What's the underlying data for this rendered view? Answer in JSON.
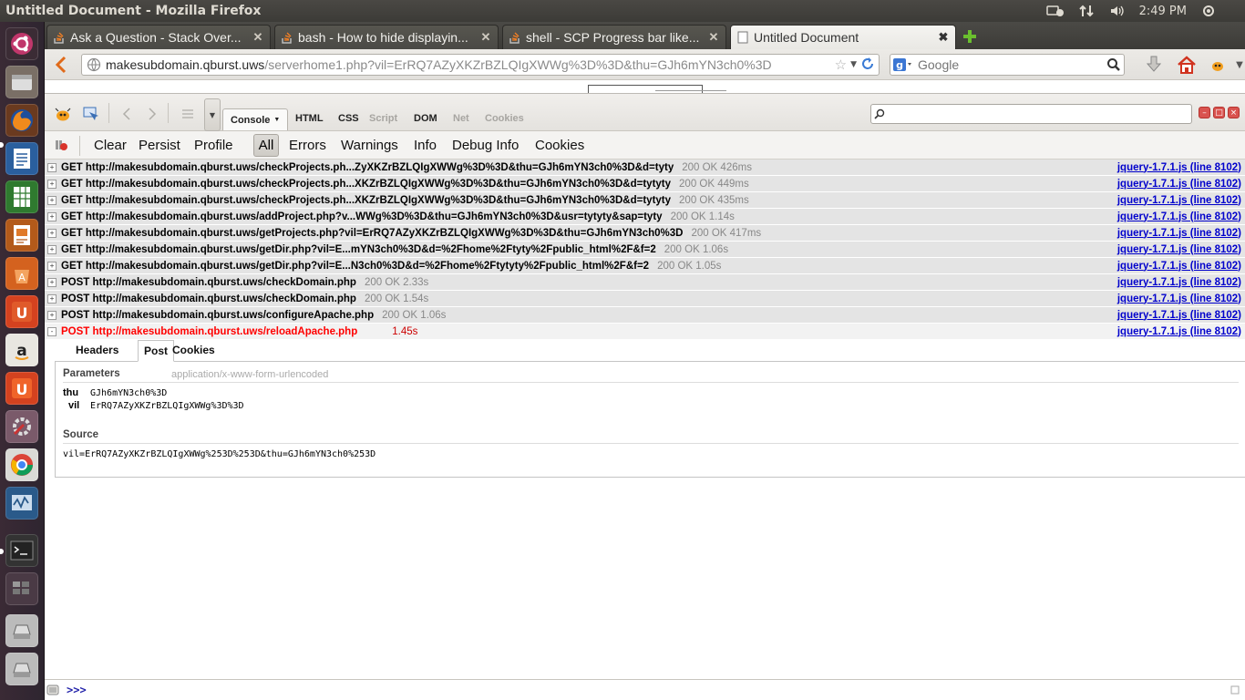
{
  "window": {
    "title": "Untitled Document - Mozilla Firefox",
    "clock": "2:49 PM"
  },
  "tabs": [
    {
      "label": "Ask a Question - Stack Over...",
      "active": false
    },
    {
      "label": "bash - How to hide displayin...",
      "active": false
    },
    {
      "label": "shell - SCP Progress bar like...",
      "active": false
    },
    {
      "label": "Untitled Document",
      "active": true
    }
  ],
  "navbar": {
    "url_domain": "makesubdomain.qburst.uws",
    "url_path": "/serverhome1.php?vil=ErRQ7AZyXKZrBZLQIgXWWg%3D%3D&thu=GJh6mYN3ch0%3D",
    "search_placeholder": "Google"
  },
  "firebug": {
    "console_tab": "Console",
    "panel_tabs": [
      "HTML",
      "CSS",
      "Script",
      "DOM",
      "Net",
      "Cookies"
    ],
    "console_buttons": {
      "clear": "Clear",
      "persist": "Persist",
      "profile": "Profile",
      "all": "All",
      "errors": "Errors",
      "warnings": "Warnings",
      "info": "Info",
      "debug": "Debug Info",
      "cookies": "Cookies"
    },
    "log_rows": [
      {
        "expander": "+",
        "request": "GET http://makesubdomain.qburst.uws/checkProjects.ph...ZyXKZrBZLQIgXWWg%3D%3D&thu=GJh6mYN3ch0%3D&d=tyty",
        "status": "200 OK 426ms",
        "source": "jquery-1.7.1.js (line 8102)"
      },
      {
        "expander": "+",
        "request": "GET http://makesubdomain.qburst.uws/checkProjects.ph...XKZrBZLQIgXWWg%3D%3D&thu=GJh6mYN3ch0%3D&d=tytyty",
        "status": "200 OK 449ms",
        "source": "jquery-1.7.1.js (line 8102)"
      },
      {
        "expander": "+",
        "request": "GET http://makesubdomain.qburst.uws/checkProjects.ph...XKZrBZLQIgXWWg%3D%3D&thu=GJh6mYN3ch0%3D&d=tytyty",
        "status": "200 OK 435ms",
        "source": "jquery-1.7.1.js (line 8102)"
      },
      {
        "expander": "+",
        "request": "GET http://makesubdomain.qburst.uws/addProject.php?v...WWg%3D%3D&thu=GJh6mYN3ch0%3D&usr=tytyty&sap=tyty",
        "status": "200 OK 1.14s",
        "source": "jquery-1.7.1.js (line 8102)"
      },
      {
        "expander": "+",
        "request": "GET http://makesubdomain.qburst.uws/getProjects.php?vil=ErRQ7AZyXKZrBZLQIgXWWg%3D%3D&thu=GJh6mYN3ch0%3D",
        "status": "200 OK 417ms",
        "source": "jquery-1.7.1.js (line 8102)"
      },
      {
        "expander": "+",
        "request": "GET http://makesubdomain.qburst.uws/getDir.php?vil=E...mYN3ch0%3D&d=%2Fhome%2Ftyty%2Fpublic_html%2F&f=2",
        "status": "200 OK 1.06s",
        "source": "jquery-1.7.1.js (line 8102)"
      },
      {
        "expander": "+",
        "request": "GET http://makesubdomain.qburst.uws/getDir.php?vil=E...N3ch0%3D&d=%2Fhome%2Ftytyty%2Fpublic_html%2F&f=2",
        "status": "200 OK 1.05s",
        "source": "jquery-1.7.1.js (line 8102)"
      },
      {
        "expander": "+",
        "request": "POST http://makesubdomain.qburst.uws/checkDomain.php",
        "status": "200 OK 2.33s",
        "source": "jquery-1.7.1.js (line 8102)"
      },
      {
        "expander": "+",
        "request": "POST http://makesubdomain.qburst.uws/checkDomain.php",
        "status": "200 OK 1.54s",
        "source": "jquery-1.7.1.js (line 8102)"
      },
      {
        "expander": "+",
        "request": "POST http://makesubdomain.qburst.uws/configureApache.php",
        "status": "200 OK 1.06s",
        "source": "jquery-1.7.1.js (line 8102)"
      },
      {
        "expander": "-",
        "request": "POST http://makesubdomain.qburst.uws/reloadApache.php",
        "status": "1.45s",
        "source": "jquery-1.7.1.js (line 8102)",
        "error": true
      }
    ],
    "detail": {
      "tabs": [
        "Headers",
        "Post",
        "Cookies"
      ],
      "parameters_title": "Parameters",
      "content_type": "application/x-www-form-urlencoded",
      "params": [
        {
          "key": "thu",
          "value": "GJh6mYN3ch0%3D"
        },
        {
          "key": "vil",
          "value": "ErRQ7AZyXKZrBZLQIgXWWg%3D%3D"
        }
      ],
      "source_title": "Source",
      "source_text": "vil=ErRQ7AZyXKZrBZLQIgXWWg%253D%253D&thu=GJh6mYN3ch0%253D"
    },
    "command_prompt": ">>>"
  },
  "colors": {
    "error_red": "#ff0000",
    "link_blue": "#0000cc",
    "panel_dark": "#3c3b37",
    "launcher_bg": "#2e2530"
  }
}
